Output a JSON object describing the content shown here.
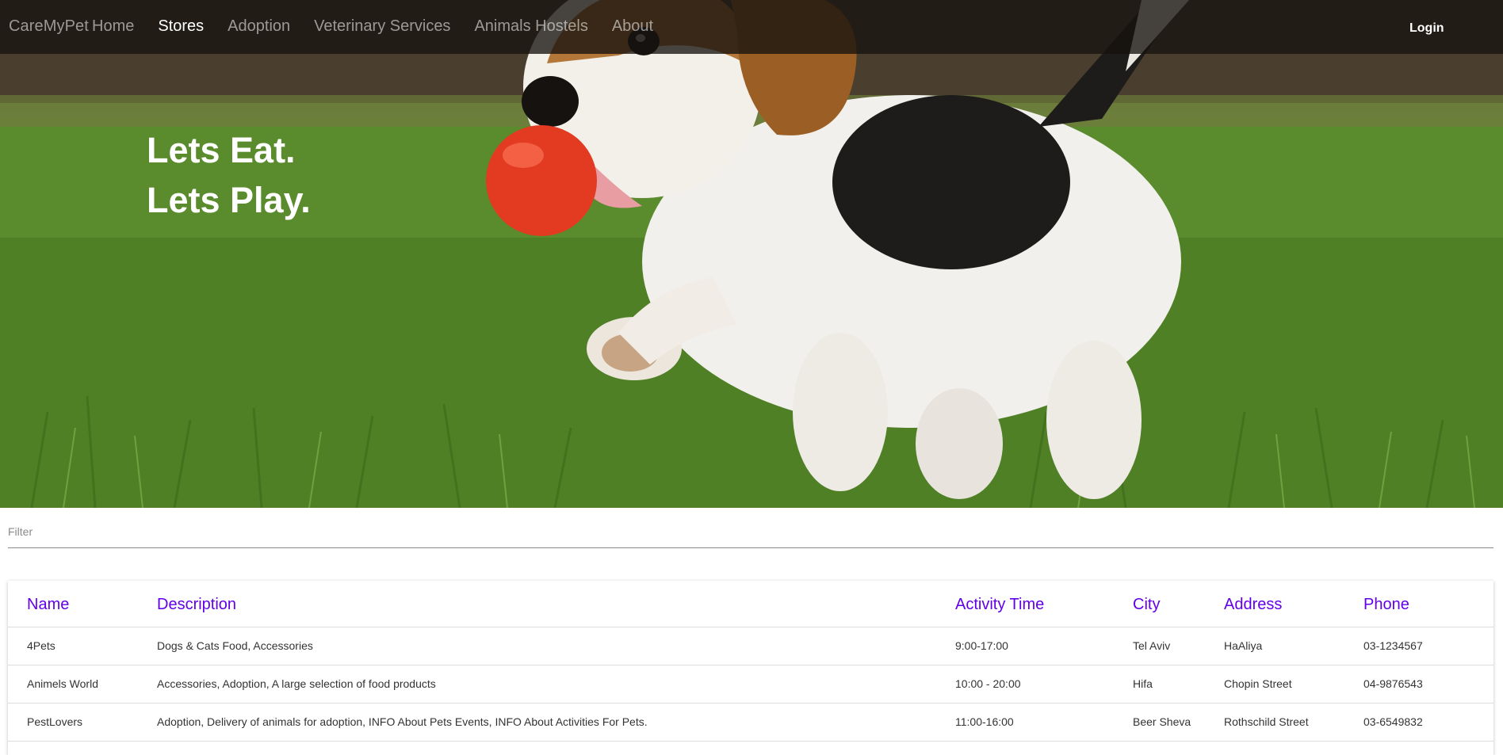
{
  "nav": {
    "brand": "CareMyPet",
    "items": [
      {
        "label": "Home",
        "active": false
      },
      {
        "label": "Stores",
        "active": true
      },
      {
        "label": "Adoption",
        "active": false
      },
      {
        "label": "Veterinary Services",
        "active": false
      },
      {
        "label": "Animals Hostels",
        "active": false
      },
      {
        "label": "About",
        "active": false
      }
    ],
    "login": "Login"
  },
  "hero": {
    "line1": "Lets Eat.",
    "line2": "Lets Play."
  },
  "filter": {
    "placeholder": "Filter",
    "value": ""
  },
  "table": {
    "headers": [
      "Name",
      "Description",
      "Activity Time",
      "City",
      "Address",
      "Phone"
    ],
    "rows": [
      [
        "4Pets",
        "Dogs & Cats Food, Accessories",
        "9:00-17:00",
        "Tel Aviv",
        "HaAliya",
        "03-1234567"
      ],
      [
        "Animels World",
        "Accessories, Adoption, A large selection of food products",
        "10:00 - 20:00",
        "Hifa",
        "Chopin Street",
        "04-9876543"
      ],
      [
        "PestLovers",
        "Adoption, Delivery of animals for adoption, INFO About Pets Events, INFO About Activities For Pets.",
        "11:00-16:00",
        "Beer Sheva",
        "Rothschild Street",
        "03-6549832"
      ]
    ]
  },
  "colors": {
    "header_text": "#6200ea",
    "nav_bg": "#16120e"
  }
}
